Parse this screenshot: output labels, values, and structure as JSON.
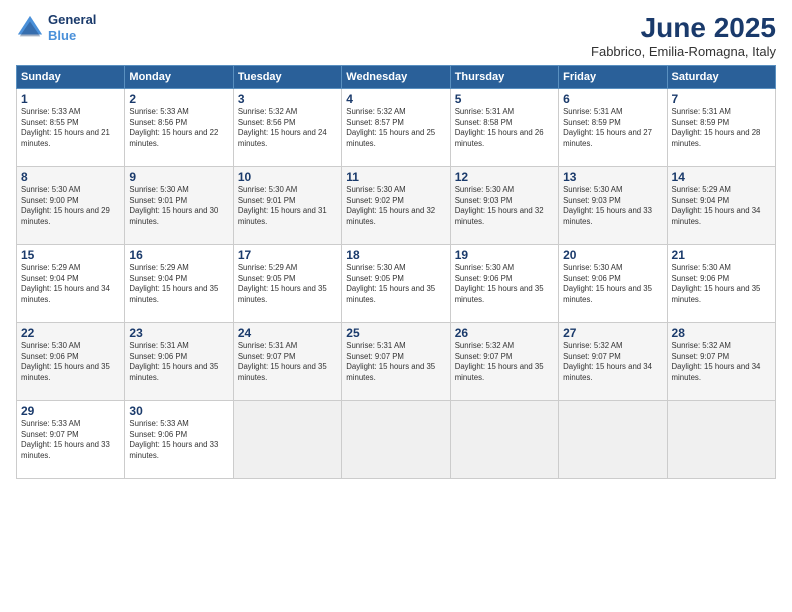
{
  "header": {
    "logo_line1": "General",
    "logo_line2": "Blue",
    "title": "June 2025",
    "subtitle": "Fabbrico, Emilia-Romagna, Italy"
  },
  "days_of_week": [
    "Sunday",
    "Monday",
    "Tuesday",
    "Wednesday",
    "Thursday",
    "Friday",
    "Saturday"
  ],
  "weeks": [
    [
      {
        "day": 1,
        "rise": "5:33 AM",
        "set": "8:55 PM",
        "daylight": "15 hours and 21 minutes."
      },
      {
        "day": 2,
        "rise": "5:33 AM",
        "set": "8:56 PM",
        "daylight": "15 hours and 22 minutes."
      },
      {
        "day": 3,
        "rise": "5:32 AM",
        "set": "8:56 PM",
        "daylight": "15 hours and 24 minutes."
      },
      {
        "day": 4,
        "rise": "5:32 AM",
        "set": "8:57 PM",
        "daylight": "15 hours and 25 minutes."
      },
      {
        "day": 5,
        "rise": "5:31 AM",
        "set": "8:58 PM",
        "daylight": "15 hours and 26 minutes."
      },
      {
        "day": 6,
        "rise": "5:31 AM",
        "set": "8:59 PM",
        "daylight": "15 hours and 27 minutes."
      },
      {
        "day": 7,
        "rise": "5:31 AM",
        "set": "8:59 PM",
        "daylight": "15 hours and 28 minutes."
      }
    ],
    [
      {
        "day": 8,
        "rise": "5:30 AM",
        "set": "9:00 PM",
        "daylight": "15 hours and 29 minutes."
      },
      {
        "day": 9,
        "rise": "5:30 AM",
        "set": "9:01 PM",
        "daylight": "15 hours and 30 minutes."
      },
      {
        "day": 10,
        "rise": "5:30 AM",
        "set": "9:01 PM",
        "daylight": "15 hours and 31 minutes."
      },
      {
        "day": 11,
        "rise": "5:30 AM",
        "set": "9:02 PM",
        "daylight": "15 hours and 32 minutes."
      },
      {
        "day": 12,
        "rise": "5:30 AM",
        "set": "9:03 PM",
        "daylight": "15 hours and 32 minutes."
      },
      {
        "day": 13,
        "rise": "5:30 AM",
        "set": "9:03 PM",
        "daylight": "15 hours and 33 minutes."
      },
      {
        "day": 14,
        "rise": "5:29 AM",
        "set": "9:04 PM",
        "daylight": "15 hours and 34 minutes."
      }
    ],
    [
      {
        "day": 15,
        "rise": "5:29 AM",
        "set": "9:04 PM",
        "daylight": "15 hours and 34 minutes."
      },
      {
        "day": 16,
        "rise": "5:29 AM",
        "set": "9:04 PM",
        "daylight": "15 hours and 35 minutes."
      },
      {
        "day": 17,
        "rise": "5:29 AM",
        "set": "9:05 PM",
        "daylight": "15 hours and 35 minutes."
      },
      {
        "day": 18,
        "rise": "5:30 AM",
        "set": "9:05 PM",
        "daylight": "15 hours and 35 minutes."
      },
      {
        "day": 19,
        "rise": "5:30 AM",
        "set": "9:06 PM",
        "daylight": "15 hours and 35 minutes."
      },
      {
        "day": 20,
        "rise": "5:30 AM",
        "set": "9:06 PM",
        "daylight": "15 hours and 35 minutes."
      },
      {
        "day": 21,
        "rise": "5:30 AM",
        "set": "9:06 PM",
        "daylight": "15 hours and 35 minutes."
      }
    ],
    [
      {
        "day": 22,
        "rise": "5:30 AM",
        "set": "9:06 PM",
        "daylight": "15 hours and 35 minutes."
      },
      {
        "day": 23,
        "rise": "5:31 AM",
        "set": "9:06 PM",
        "daylight": "15 hours and 35 minutes."
      },
      {
        "day": 24,
        "rise": "5:31 AM",
        "set": "9:07 PM",
        "daylight": "15 hours and 35 minutes."
      },
      {
        "day": 25,
        "rise": "5:31 AM",
        "set": "9:07 PM",
        "daylight": "15 hours and 35 minutes."
      },
      {
        "day": 26,
        "rise": "5:32 AM",
        "set": "9:07 PM",
        "daylight": "15 hours and 35 minutes."
      },
      {
        "day": 27,
        "rise": "5:32 AM",
        "set": "9:07 PM",
        "daylight": "15 hours and 34 minutes."
      },
      {
        "day": 28,
        "rise": "5:32 AM",
        "set": "9:07 PM",
        "daylight": "15 hours and 34 minutes."
      }
    ],
    [
      {
        "day": 29,
        "rise": "5:33 AM",
        "set": "9:07 PM",
        "daylight": "15 hours and 33 minutes."
      },
      {
        "day": 30,
        "rise": "5:33 AM",
        "set": "9:06 PM",
        "daylight": "15 hours and 33 minutes."
      },
      null,
      null,
      null,
      null,
      null
    ]
  ]
}
